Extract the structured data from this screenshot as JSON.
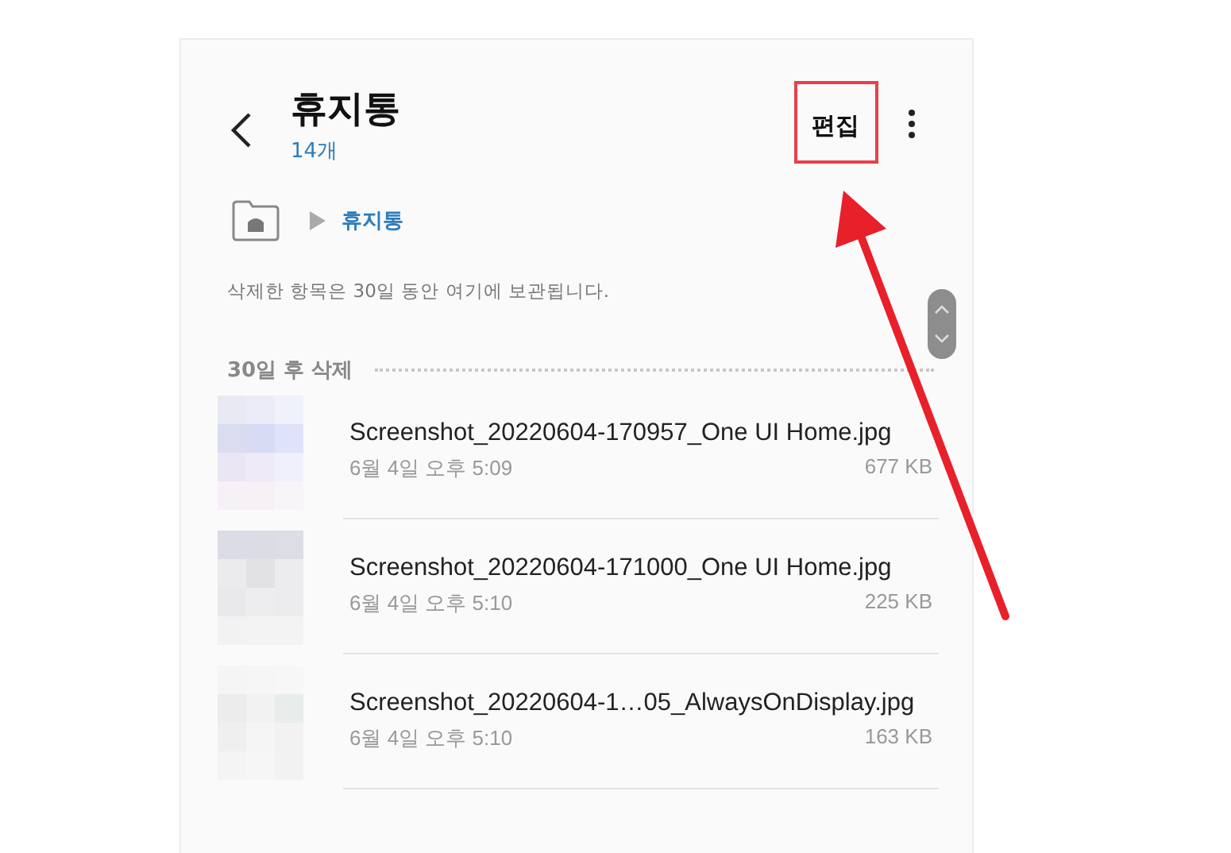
{
  "header": {
    "title": "휴지통",
    "count": "14개",
    "edit": "편집"
  },
  "breadcrumb": {
    "current": "휴지통"
  },
  "notice": "삭제한 항목은 30일 동안 여기에 보관됩니다.",
  "section": {
    "title": "30일 후 삭제"
  },
  "files": [
    {
      "name": "Screenshot_20220604-170957_One UI Home.jpg",
      "date": "6월 4일 오후 5:09",
      "size": "677 KB"
    },
    {
      "name": "Screenshot_20220604-171000_One UI Home.jpg",
      "date": "6월 4일 오후 5:10",
      "size": "225 KB"
    },
    {
      "name": "Screenshot_20220604-1…05_AlwaysOnDisplay.jpg",
      "date": "6월 4일 오후 5:10",
      "size": "163 KB"
    }
  ]
}
